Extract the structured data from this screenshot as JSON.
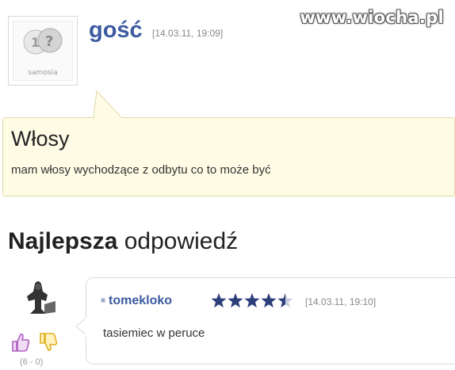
{
  "watermark": "www.wiocha.pl",
  "question": {
    "avatar_brand": "samosia",
    "avatar_glyphs": "1?",
    "author": "gość",
    "date": "[14.03.11, 19:09]",
    "title": "Włosy",
    "body": "mam włosy wychodzące z odbytu co to może być"
  },
  "best_answer": {
    "heading_bold": "Najlepsza",
    "heading_rest": " odpowiedź",
    "author": "tomekloko",
    "rating_stars": 4.5,
    "date": "[14.03.11, 19:10]",
    "text": "tasiemiec w peruce",
    "votes": "(6 - 0)"
  },
  "colors": {
    "username": "#3b5aa0",
    "bubble_bg": "#fffce6",
    "star": "#2d3f7a",
    "thumb_up": "#b05cc0",
    "thumb_down": "#e0b020"
  },
  "icons": [
    "avatar-question-icon",
    "rating-star-icon",
    "thumb-up-icon",
    "thumb-down-icon"
  ]
}
